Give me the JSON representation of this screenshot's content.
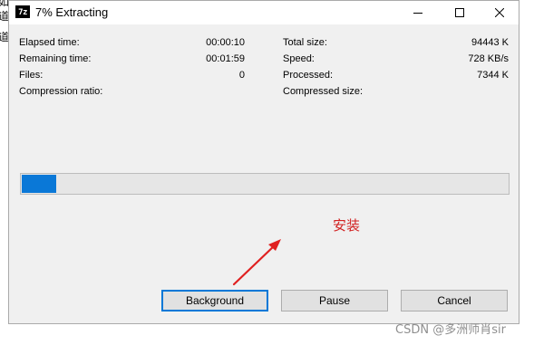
{
  "background_doc": {
    "fragments": [
      "如",
      "道",
      "道"
    ]
  },
  "window": {
    "icon_label": "7z",
    "title": "7% Extracting",
    "controls": [
      "minimize-icon",
      "maximize-icon",
      "close-icon"
    ]
  },
  "stats": {
    "left": [
      {
        "label": "Elapsed time:",
        "value": "00:00:10"
      },
      {
        "label": "Remaining time:",
        "value": "00:01:59"
      },
      {
        "label": "Files:",
        "value": "0"
      },
      {
        "label": "Compression ratio:",
        "value": ""
      }
    ],
    "right": [
      {
        "label": "Total size:",
        "value": "94443 K"
      },
      {
        "label": "Speed:",
        "value": "728 KB/s"
      },
      {
        "label": "Processed:",
        "value": "7344 K"
      },
      {
        "label": "Compressed size:",
        "value": ""
      }
    ]
  },
  "progress": {
    "percent": 7
  },
  "buttons": {
    "background": "Background",
    "pause": "Pause",
    "cancel": "Cancel"
  },
  "annotation": {
    "text": "安装",
    "color": "#d22222"
  },
  "watermark": "CSDN @多洲师肖sir",
  "colors": {
    "progress_fill": "#0a78d7",
    "default_button_border": "#0078d7",
    "window_bg": "#f0f0f0"
  }
}
